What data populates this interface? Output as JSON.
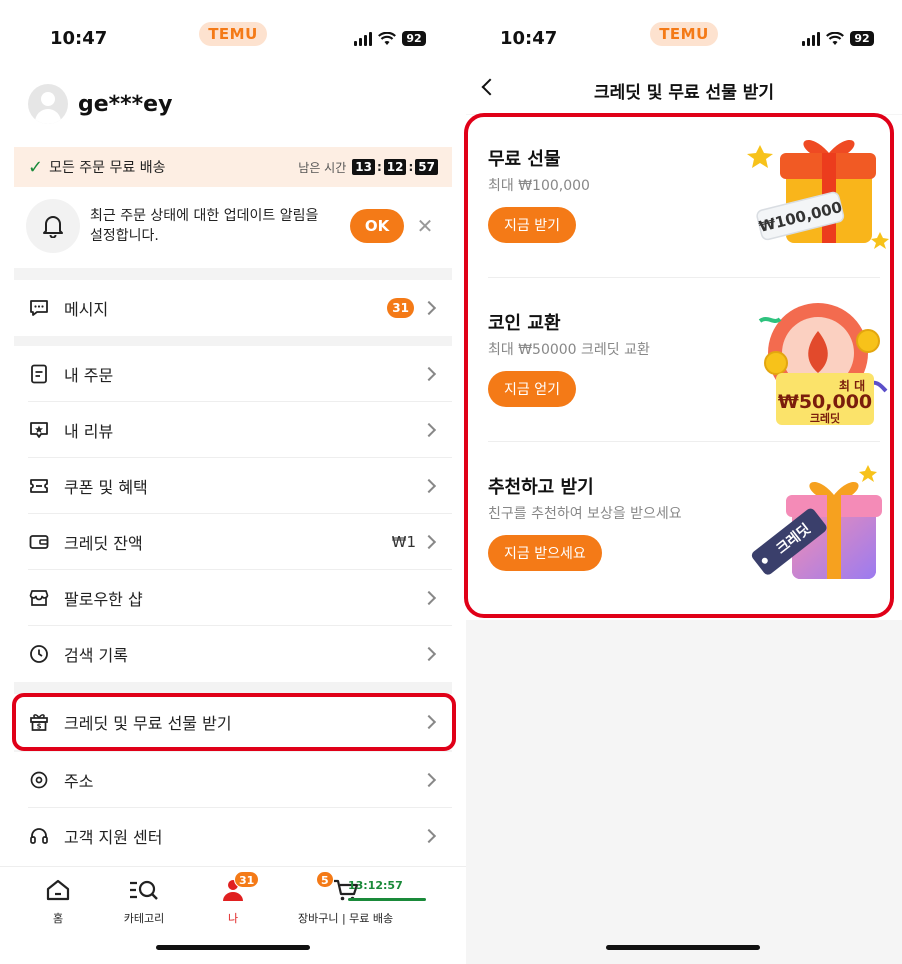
{
  "left_screen": {
    "status": {
      "time": "10:47",
      "brand": "TEMU",
      "battery": "92"
    },
    "profile": {
      "username": "ge***ey"
    },
    "shipping_banner": {
      "text": "모든 주문 무료 배송",
      "remaining_label": "남은 시간",
      "hours": "13",
      "minutes": "12",
      "seconds": "57"
    },
    "notification": {
      "text": "최근 주문 상태에 대한 업데이트 알림을 설정합니다.",
      "ok_label": "OK"
    },
    "menu": [
      {
        "label": "메시지",
        "badge": "31",
        "icon": "message-icon"
      },
      {
        "label": "내 주문",
        "icon": "orders-icon"
      },
      {
        "label": "내 리뷰",
        "icon": "review-icon"
      },
      {
        "label": "쿠폰 및 혜택",
        "icon": "coupon-icon"
      },
      {
        "label": "크레딧 잔액",
        "value": "₩1",
        "icon": "wallet-icon"
      },
      {
        "label": "팔로우한 샵",
        "icon": "shop-icon"
      },
      {
        "label": "검색 기록",
        "icon": "clock-icon"
      },
      {
        "label": "크레딧 및 무료 선물 받기",
        "icon": "gift-icon"
      },
      {
        "label": "주소",
        "icon": "location-icon"
      },
      {
        "label": "고객 지원 센터",
        "icon": "headset-icon"
      }
    ],
    "tabbar": {
      "home": "홈",
      "categories": "카테고리",
      "me": "나",
      "me_badge": "31",
      "cart": "장바구니 | 무료 배송",
      "cart_badge": "5",
      "timer": "13:12:57"
    }
  },
  "right_screen": {
    "status": {
      "time": "10:47",
      "brand": "TEMU",
      "battery": "92"
    },
    "nav_title": "크레딧 및 무료 선물 받기",
    "cards": [
      {
        "title": "무료 선물",
        "subtitle": "최대 ₩100,000",
        "button": "지금 받기",
        "art_text": "₩100,000"
      },
      {
        "title": "코인 교환",
        "subtitle": "최대 ₩50000 크레딧 교환",
        "button": "지금 얻기",
        "art_top": "최 대",
        "art_amount": "₩50,000",
        "art_unit": "크레딧"
      },
      {
        "title": "추천하고 받기",
        "subtitle": "친구를 추천하여 보상을 받으세요",
        "button": "지금 받으세요",
        "art_tag": "크레딧"
      }
    ]
  },
  "colors": {
    "accent": "#f47a17",
    "highlight": "#e00018",
    "shipping_green": "#1a8a3a"
  }
}
